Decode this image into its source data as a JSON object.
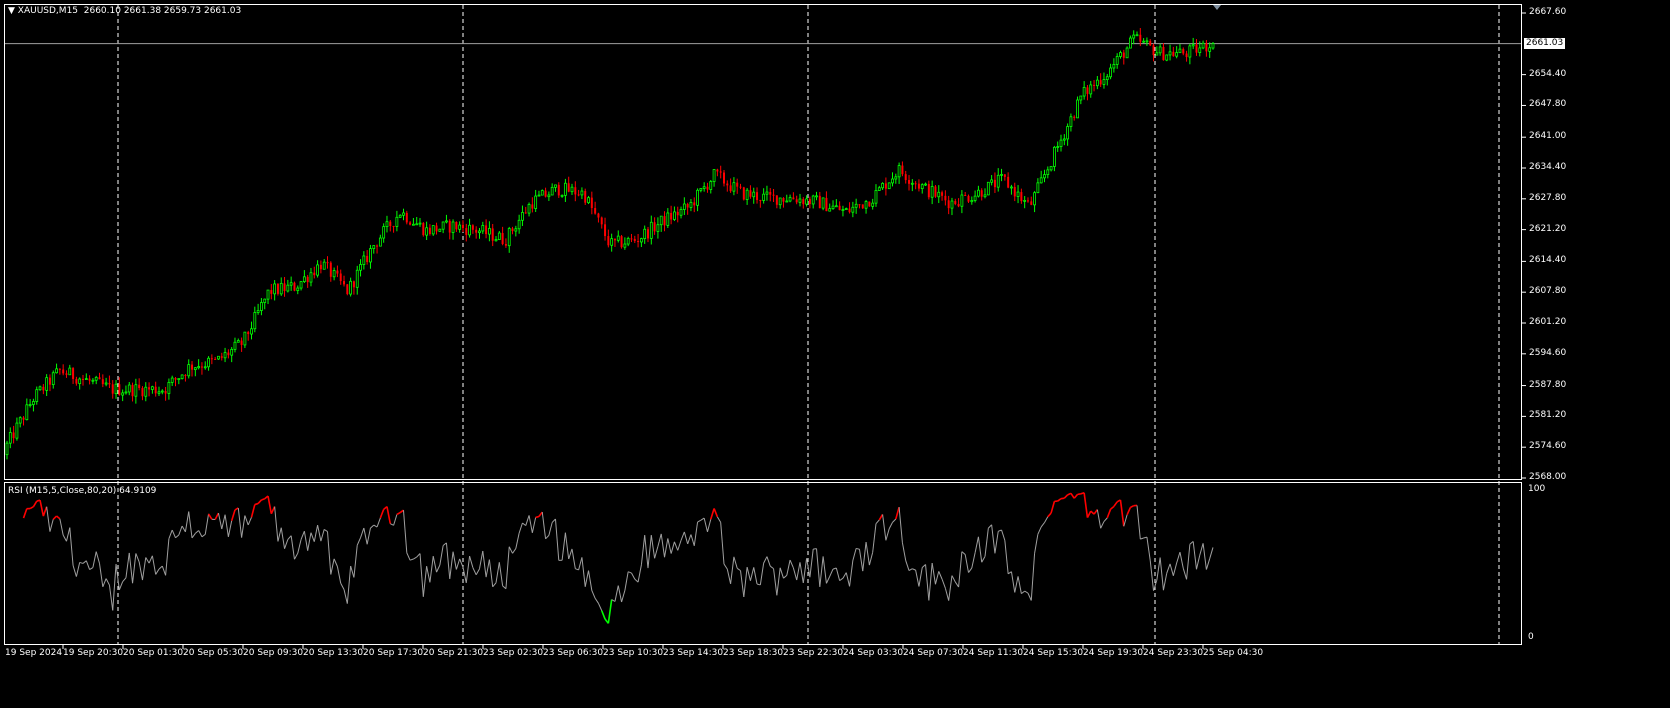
{
  "header": {
    "symbol_timeframe": "XAUUSD,M15",
    "ohlc": "2660.10 2661.38 2659.73 2661.03",
    "collapse_icon": "triangle-down-icon"
  },
  "price_axis": {
    "labels": [
      "2667.60",
      "2654.40",
      "2647.80",
      "2641.00",
      "2634.40",
      "2627.80",
      "2621.20",
      "2614.40",
      "2607.80",
      "2601.20",
      "2594.60",
      "2587.80",
      "2581.20",
      "2574.60",
      "2568.00"
    ],
    "current_price": "2661.03"
  },
  "rsi": {
    "label": "RSI (M15,5,Close,80,20) 64.9109",
    "max_label": "100",
    "min_label": "0",
    "period": 5,
    "upper_level": 80,
    "lower_level": 20
  },
  "time_axis": {
    "labels": [
      "19 Sep 2024",
      "19 Sep 20:30",
      "20 Sep 01:30",
      "20 Sep 05:30",
      "20 Sep 09:30",
      "20 Sep 13:30",
      "20 Sep 17:30",
      "20 Sep 21:30",
      "23 Sep 02:30",
      "23 Sep 06:30",
      "23 Sep 10:30",
      "23 Sep 14:30",
      "23 Sep 18:30",
      "23 Sep 22:30",
      "24 Sep 03:30",
      "24 Sep 07:30",
      "24 Sep 11:30",
      "24 Sep 15:30",
      "24 Sep 19:30",
      "24 Sep 23:30",
      "25 Sep 04:30"
    ]
  },
  "colors": {
    "background": "#000000",
    "bull_candle": "#00ff00",
    "bear_candle": "#ff0000",
    "grid": "#ffffff",
    "rsi_line": "#a0a0a0",
    "rsi_overbought": "#ff0000",
    "rsi_oversold": "#00ff00"
  },
  "chart_data": {
    "type": "candlestick",
    "symbol": "XAUUSD",
    "timeframe": "M15",
    "ylim": [
      2568.0,
      2667.6
    ],
    "last_bar": {
      "open": 2660.1,
      "high": 2661.38,
      "low": 2659.73,
      "close": 2661.03
    },
    "approx_close_path": [
      2575,
      2585,
      2591,
      2589,
      2587,
      2587,
      2587,
      2592,
      2593,
      2597,
      2608,
      2609,
      2614,
      2608,
      2618,
      2625,
      2621,
      2622,
      2621,
      2619,
      2627,
      2630,
      2629,
      2618,
      2619,
      2623,
      2626,
      2633,
      2629,
      2628,
      2628,
      2627,
      2625,
      2628,
      2634,
      2630,
      2627,
      2629,
      2632,
      2626,
      2638,
      2650,
      2655,
      2662,
      2659,
      2659,
      2661.03
    ]
  }
}
